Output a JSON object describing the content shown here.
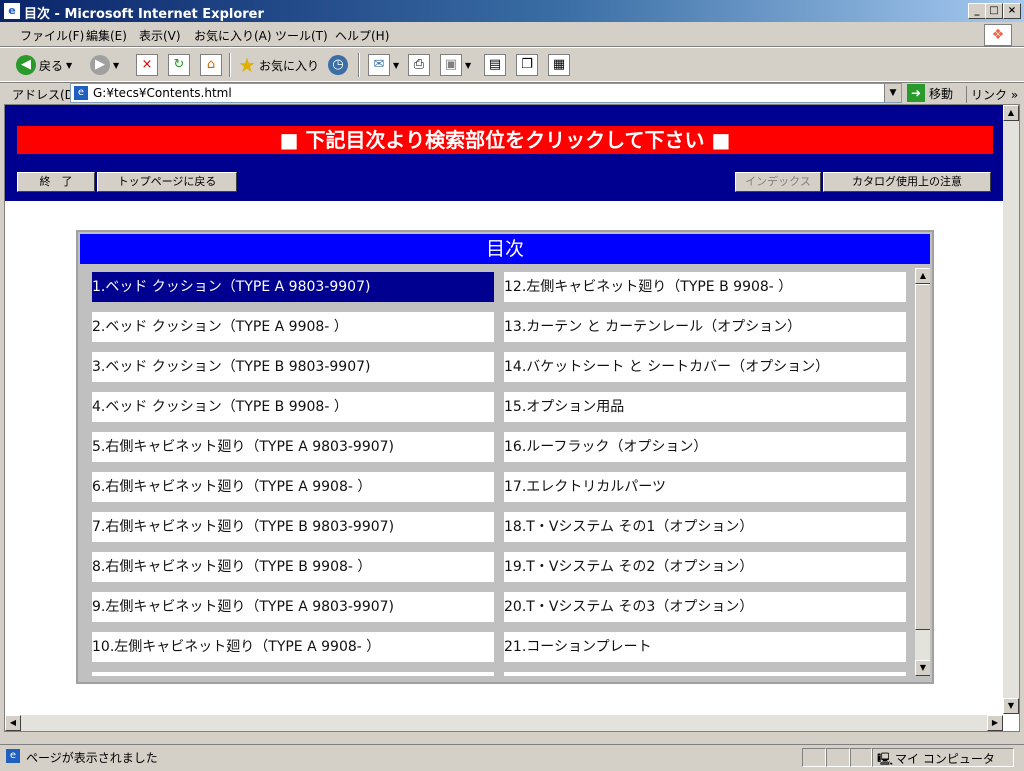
{
  "window": {
    "title": "目次 - Microsoft Internet Explorer"
  },
  "menu": [
    "ファイル(F)",
    "編集(E)",
    "表示(V)",
    "お気に入り(A)",
    "ツール(T)",
    "ヘルプ(H)"
  ],
  "toolbar": {
    "back_label": "戻る",
    "favorites_label": "お気に入り"
  },
  "address": {
    "label": "アドレス(D)",
    "value": "G:¥tecs¥Contents.html",
    "go_label": "移動",
    "links_label": "リンク"
  },
  "page": {
    "banner": "■ 下記目次より検索部位をクリックして下さい ■",
    "buttons": {
      "exit": "終　了",
      "top": "トップページに戻る",
      "index": "インデックス",
      "notice": "カタログ使用上の注意"
    },
    "toc_title": "目次",
    "toc_left": [
      "1.ベッド クッション（TYPE A 9803-9907)",
      "2.ベッド クッション（TYPE A 9908- ）",
      "3.ベッド クッション（TYPE B 9803-9907)",
      "4.ベッド クッション（TYPE B 9908- ）",
      "5.右側キャビネット廻り（TYPE A 9803-9907)",
      "6.右側キャビネット廻り（TYPE A 9908- ）",
      "7.右側キャビネット廻り（TYPE B 9803-9907)",
      "8.右側キャビネット廻り（TYPE B 9908- ）",
      "9.左側キャビネット廻り（TYPE A 9803-9907)",
      "10.左側キャビネット廻り（TYPE A 9908- ）"
    ],
    "toc_right": [
      "12.左側キャビネット廻り（TYPE B 9908- ）",
      "13.カーテン と カーテンレール（オプション）",
      "14.バケットシート と シートカバー（オプション）",
      "15.オプション用品",
      "16.ルーフラック（オプション）",
      "17.エレクトリカルパーツ",
      "18.T・Vシステム その1（オプション）",
      "19.T・Vシステム その2（オプション）",
      "20.T・Vシステム その3（オプション）",
      "21.コーションプレート"
    ]
  },
  "status": {
    "text": "ページが表示されました",
    "zone": "マイ コンピュータ"
  },
  "colors": {
    "header_bg": "#000090",
    "banner_bg": "#ff0000",
    "toc_head_bg": "#0000ff",
    "selected_bg": "#000090"
  }
}
